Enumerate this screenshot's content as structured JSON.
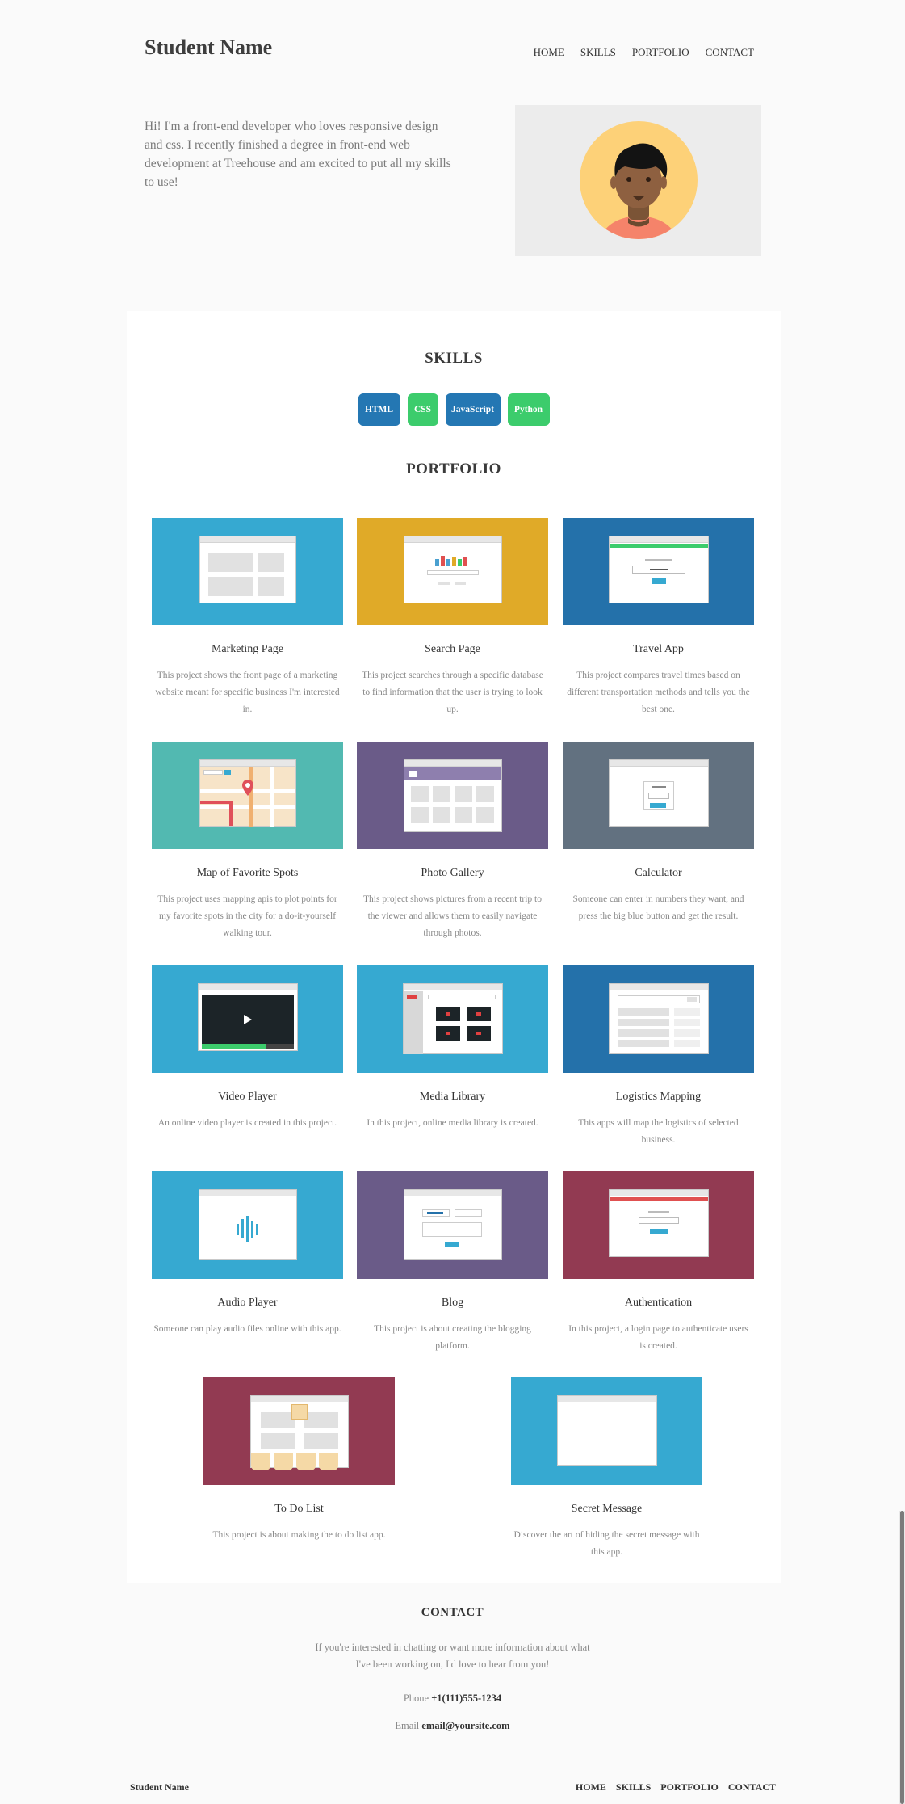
{
  "header": {
    "title": "Student Name",
    "nav": [
      "HOME",
      "SKILLS",
      "PORTFOLIO",
      "CONTACT"
    ]
  },
  "intro": {
    "text": "Hi! I'm a front-end developer who loves responsive design and css. I recently finished a degree in front-end web development at Treehouse and am excited to put all my skills to use!"
  },
  "skills": {
    "heading": "SKILLS",
    "items": [
      {
        "label": "HTML",
        "color": "#2477b3"
      },
      {
        "label": "CSS",
        "color": "#3ccc6c"
      },
      {
        "label": "JavaScript",
        "color": "#2477b3"
      },
      {
        "label": "Python",
        "color": "#3ccc6c"
      }
    ]
  },
  "portfolio": {
    "heading": "PORTFOLIO",
    "projects": [
      {
        "title": "Marketing Page",
        "desc": "This project shows the front page of a marketing website meant for specific business I'm interested in.",
        "color": "#36a9d1"
      },
      {
        "title": "Search Page",
        "desc": "This project searches through a specific database to find information that the user is trying to look up.",
        "color": "#e0aa28"
      },
      {
        "title": "Travel App",
        "desc": "This project compares travel times based on different transportation methods and tells you the best one.",
        "color": "#2471aa"
      },
      {
        "title": "Map of Favorite Spots",
        "desc": "This project uses mapping apis to plot points for my favorite spots in the city for a do-it-yourself walking tour.",
        "color": "#52b9b1"
      },
      {
        "title": "Photo Gallery",
        "desc": "This project shows pictures from a recent trip to the viewer and allows them to easily navigate through photos.",
        "color": "#6a5b88"
      },
      {
        "title": "Calculator",
        "desc": "Someone can enter in numbers they want, and press the big blue button and get the result.",
        "color": "#627180"
      },
      {
        "title": "Video Player",
        "desc": "An online video player is created in this project.",
        "color": "#36a9d1"
      },
      {
        "title": "Media Library",
        "desc": "In this project, online media library is created.",
        "color": "#36a9d1"
      },
      {
        "title": "Logistics Mapping",
        "desc": "This apps will map the logistics of selected business.",
        "color": "#2471aa"
      },
      {
        "title": "Audio Player",
        "desc": "Someone can play audio files online with this app.",
        "color": "#36a9d1"
      },
      {
        "title": "Blog",
        "desc": "This project is about creating the blogging platform.",
        "color": "#6a5b88"
      },
      {
        "title": "Authentication",
        "desc": "In this project, a login page to authenticate users is created.",
        "color": "#923a52"
      },
      {
        "title": "To Do List",
        "desc": "This project is about making the to do list app.",
        "color": "#923a52"
      },
      {
        "title": "Secret Message",
        "desc": "Discover the art of hiding the secret message with this app.",
        "color": "#36a9d1"
      }
    ]
  },
  "contact": {
    "heading": "CONTACT",
    "text": "If you're interested in chatting or want more information about what I've been working on, I'd love to hear from you!",
    "phone_label": "Phone",
    "phone": "+1(111)555-1234",
    "email_label": "Email",
    "email": "email@yoursite.com"
  },
  "footer": {
    "name": "Student Name",
    "nav": [
      "HOME",
      "SKILLS",
      "PORTFOLIO",
      "CONTACT"
    ]
  }
}
